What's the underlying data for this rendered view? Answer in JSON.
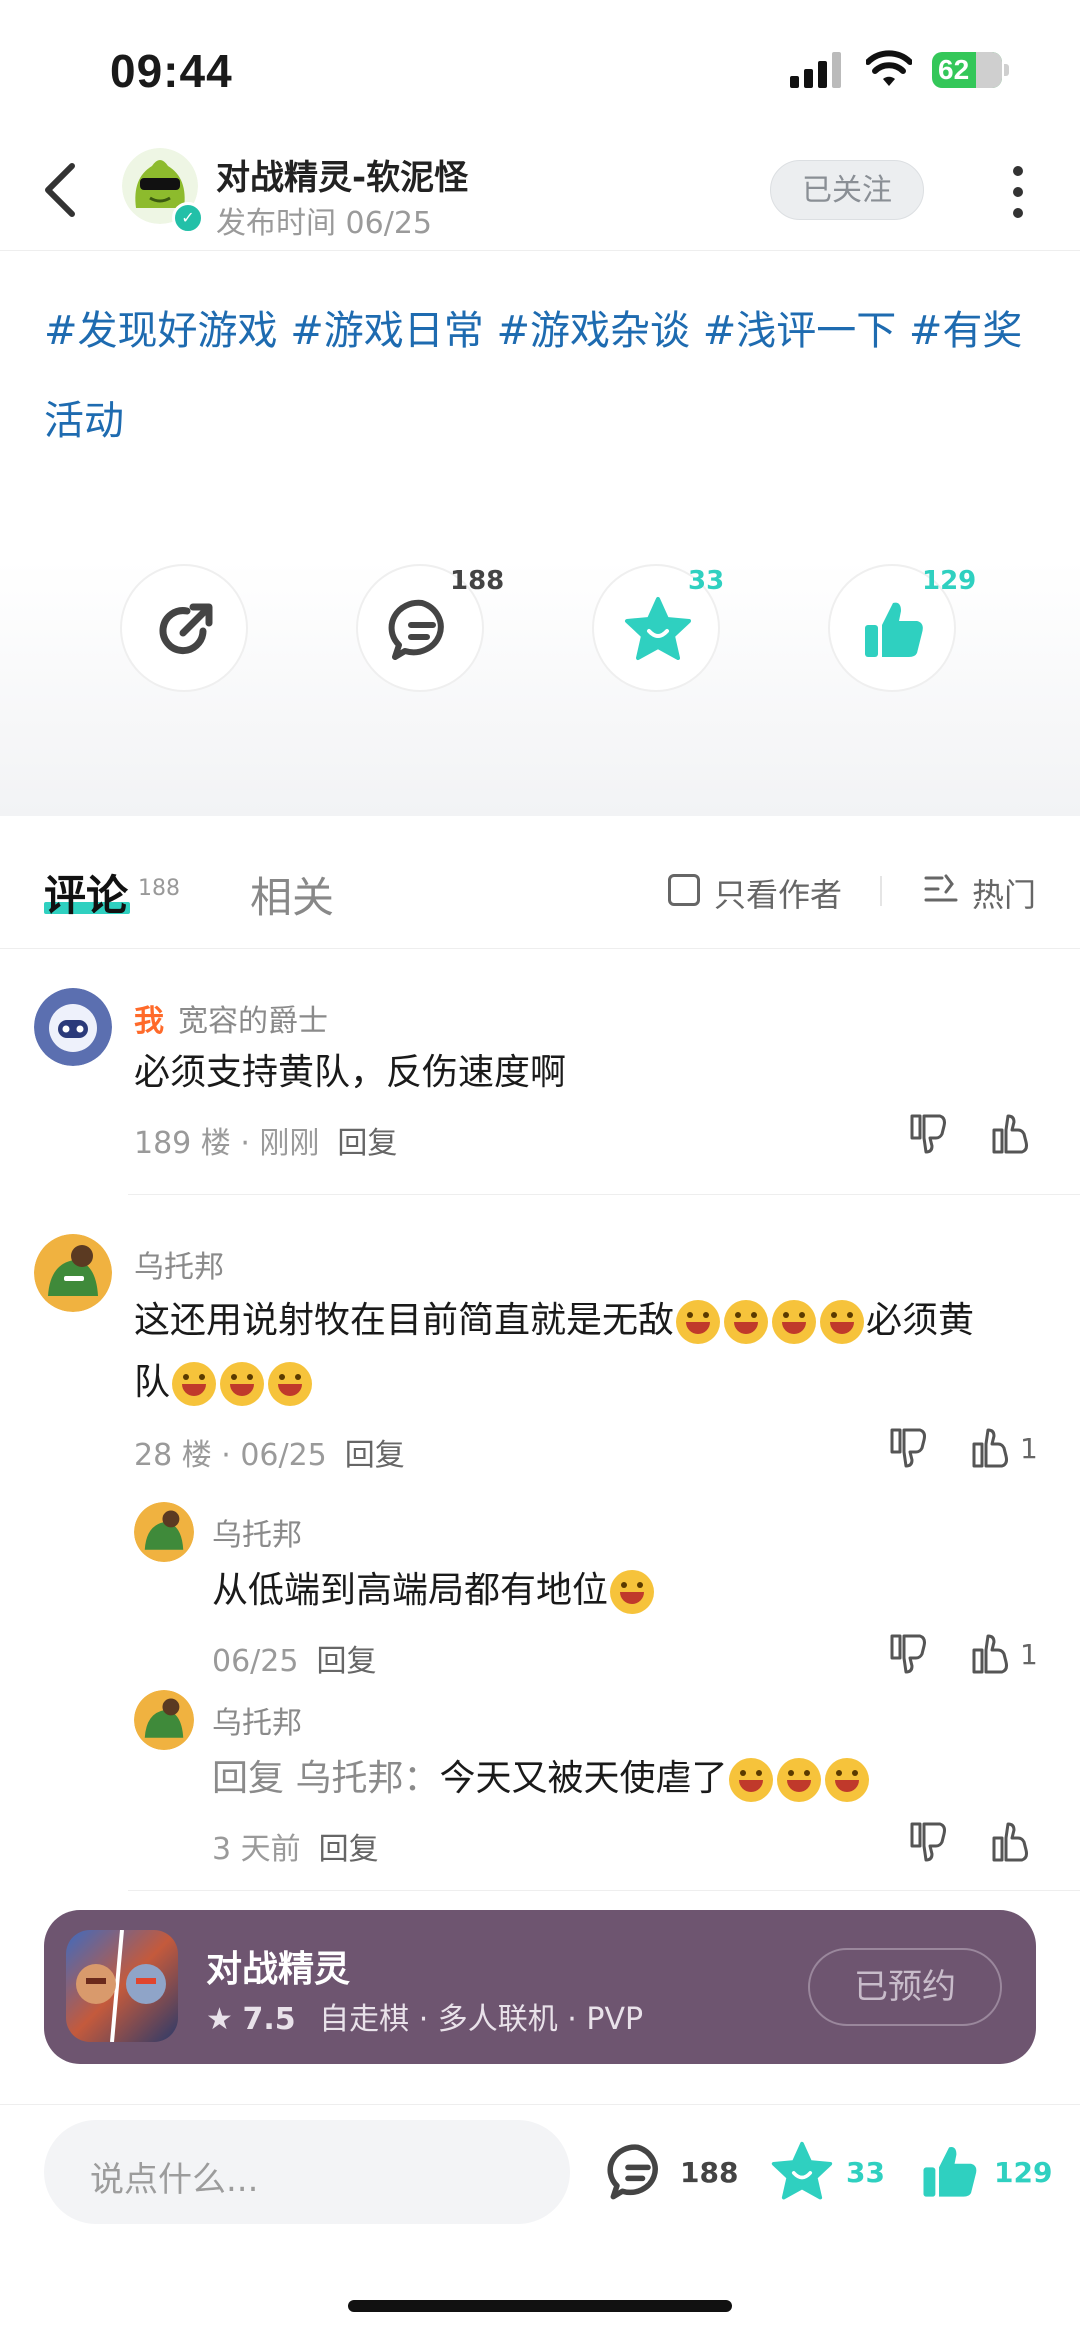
{
  "status_bar": {
    "time": "09:44",
    "battery": "62"
  },
  "header": {
    "author_name": "对战精灵-软泥怪",
    "post_time": "发布时间 06/25",
    "follow_label": "已关注"
  },
  "post": {
    "tags": "#发现好游戏 #游戏日常 #游戏杂谈 #浅评一下 #有奖活动"
  },
  "actions": {
    "comment_count": "188",
    "favorite_count": "33",
    "like_count": "129"
  },
  "tabs": {
    "comment_label": "评论",
    "comment_count": "188",
    "related_label": "相关",
    "only_author_label": "只看作者",
    "sort_label": "热门"
  },
  "comments": [
    {
      "me_tag": "我",
      "name": "宽容的爵士",
      "text": "必须支持黄队，反伤速度啊",
      "floor": "189 楼 · 刚刚",
      "reply": "回复"
    },
    {
      "name": "乌托邦",
      "text_line1": "这还用说射牧在目前简直就是无敌",
      "text_line1_tail": "必须黄",
      "text_line2": "队",
      "floor": "28 楼 · 06/25",
      "reply": "回复",
      "like_count": "1",
      "replies": [
        {
          "name": "乌托邦",
          "text": "从低端到高端局都有地位",
          "time": "06/25",
          "reply": "回复",
          "like_count": "1"
        },
        {
          "name": "乌托邦",
          "reply_prefix": "回复 乌托邦：",
          "text": "今天又被天使虐了",
          "time": "3 天前",
          "reply": "回复"
        }
      ]
    }
  ],
  "game_card": {
    "name": "对战精灵",
    "rating": "7.5",
    "tags": "自走棋 · 多人联机 · PVP",
    "button": "已预约"
  },
  "bottom_bar": {
    "input_placeholder": "说点什么...",
    "comment_count": "188",
    "favorite_count": "33",
    "like_count": "129"
  },
  "colors": {
    "accent": "#2fd0c0",
    "tag_blue": "#1e6bb0",
    "card_bg": "#6e5570",
    "me_orange": "#ff6a2a"
  }
}
